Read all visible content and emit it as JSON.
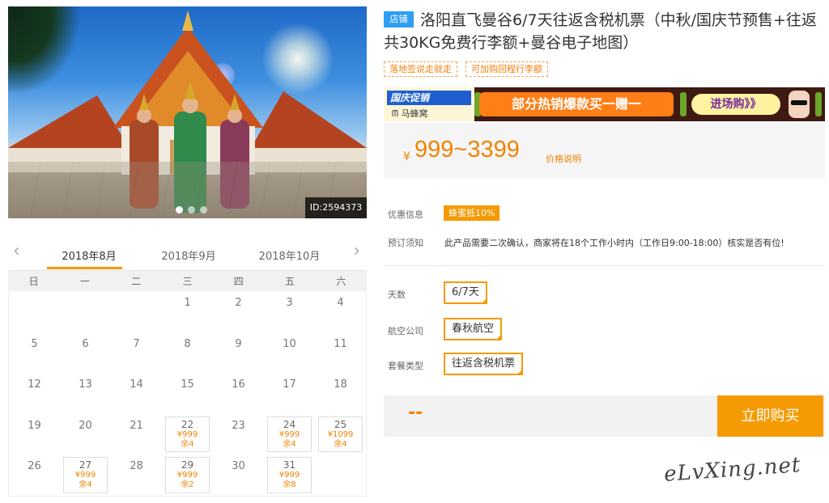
{
  "hero": {
    "id_label": "ID:2594373",
    "slide_count": 3,
    "active_slide": 0
  },
  "calendar": {
    "months": [
      "2018年8月",
      "2018年9月",
      "2018年10月"
    ],
    "active_month": 0,
    "prev_icon": "chevron-left-icon",
    "next_icon": "chevron-right-icon",
    "weekdays": [
      "日",
      "一",
      "二",
      "三",
      "四",
      "五",
      "六"
    ],
    "first_weekday": 3,
    "days_in_month": 31,
    "available": {
      "22": {
        "price": "¥999",
        "stock": "余4"
      },
      "24": {
        "price": "¥999",
        "stock": "余4"
      },
      "25": {
        "price": "¥1099",
        "stock": "余4"
      },
      "27": {
        "price": "¥999",
        "stock": "余4"
      },
      "29": {
        "price": "¥999",
        "stock": "余2"
      },
      "31": {
        "price": "¥999",
        "stock": "余8"
      }
    }
  },
  "product": {
    "store_badge": "店铺",
    "title": "洛阳直飞曼谷6/7天往返含税机票（中秋/国庆节预售+往返共30KG免费行李额+曼谷电子地图）",
    "tags": [
      "落地签说走就走",
      "可加购回程行李额"
    ]
  },
  "banner": {
    "flag": "国庆促销",
    "brand": "马蜂窝",
    "headline": "部分热销爆款买一赠一",
    "cta": "进场购》》"
  },
  "price": {
    "currency": "¥",
    "range": "999~3399",
    "explain": "价格说明"
  },
  "info": {
    "discount_label": "优惠信息",
    "discount_value": "蜂蜜抵10%",
    "notice_label": "预订须知",
    "notice_value": "此产品需要二次确认，商家将在18个工作小时内（工作日9:00-18:00）核实是否有位!"
  },
  "options": {
    "days_label": "天数",
    "days_value": "6/7天",
    "airline_label": "航空公司",
    "airline_value": "春秋航空",
    "package_label": "套餐类型",
    "package_value": "往返含税机票"
  },
  "buy": {
    "total": "--",
    "button": "立即购买"
  },
  "watermark": "eLvXing.net",
  "colors": {
    "accent": "#f59a00",
    "price": "#f08300",
    "store_badge": "#2e9ff4"
  }
}
